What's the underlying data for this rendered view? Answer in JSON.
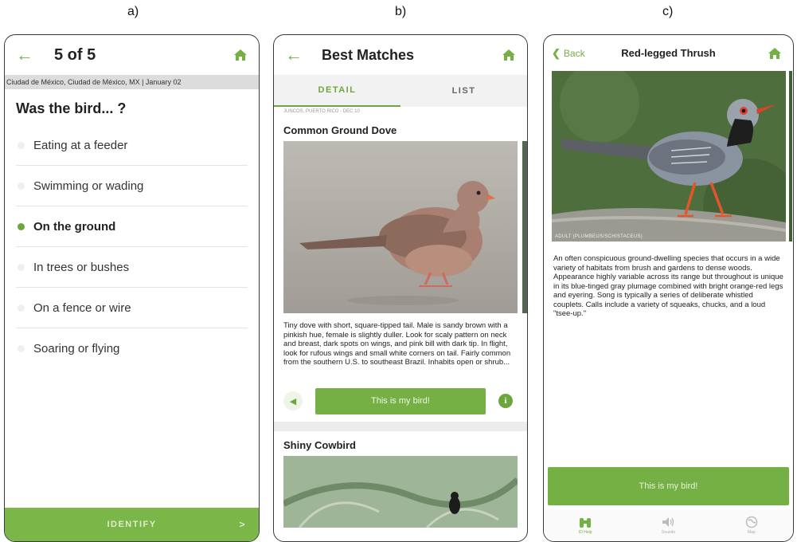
{
  "labels": {
    "a": "a)",
    "b": "b)",
    "c": "c)"
  },
  "screen_a": {
    "header_title": "5 of 5",
    "location": "Ciudad de México, Ciudad de México, MX | January 02",
    "question": "Was the bird... ?",
    "options": [
      {
        "label": "Eating at a feeder",
        "selected": false
      },
      {
        "label": "Swimming or wading",
        "selected": false
      },
      {
        "label": "On the ground",
        "selected": true
      },
      {
        "label": "In trees or bushes",
        "selected": false
      },
      {
        "label": "On a fence or wire",
        "selected": false
      },
      {
        "label": "Soaring or flying",
        "selected": false
      }
    ],
    "identify_label": "IDENTIFY",
    "identify_chevron": ">"
  },
  "screen_b": {
    "header_title": "Best Matches",
    "tabs": [
      "DETAIL",
      "LIST"
    ],
    "active_tab": "DETAIL",
    "location": "JUNCOS, PUERTO RICO - DEC 10",
    "species_1": "Common Ground Dove",
    "description_1": "Tiny dove with short, square-tipped tail. Male is sandy brown with a pinkish hue, female is slightly duller. Look for scaly pattern on neck and breast, dark spots on wings, and pink bill with dark tip. In flight, look for rufous wings and small white corners on tail. Fairly common from the southern U.S. to southeast Brazil. Inhabits open or shrub...",
    "my_bird_label": "This is my bird!",
    "info_glyph": "i",
    "species_2": "Shiny Cowbird"
  },
  "screen_c": {
    "back_label": "Back",
    "header_title": "Red-legged Thrush",
    "photo_caption": "ADULT (PLUMBEUS/SCHISTACEUS)",
    "description": "An often conspicuous ground-dwelling species that occurs in a wide variety of habitats from brush and gardens to dense woods. Appearance highly variable across its range but throughout is unique in its blue-tinged gray plumage combined with bright orange-red legs and eyering. Song is typically a series of deliberate whistled couplets. Calls include a variety of squeaks, chucks, and a loud \"tsee-up.\"",
    "my_bird_label": "This is my bird!",
    "nav": [
      {
        "label": "ID Help",
        "icon": "binoculars-icon"
      },
      {
        "label": "Sounds",
        "icon": "speaker-icon"
      },
      {
        "label": "Map",
        "icon": "globe-icon"
      }
    ]
  },
  "colors": {
    "accent": "#74b044",
    "selected_dot": "#6ea63e",
    "strip": "#dcdcdc"
  }
}
